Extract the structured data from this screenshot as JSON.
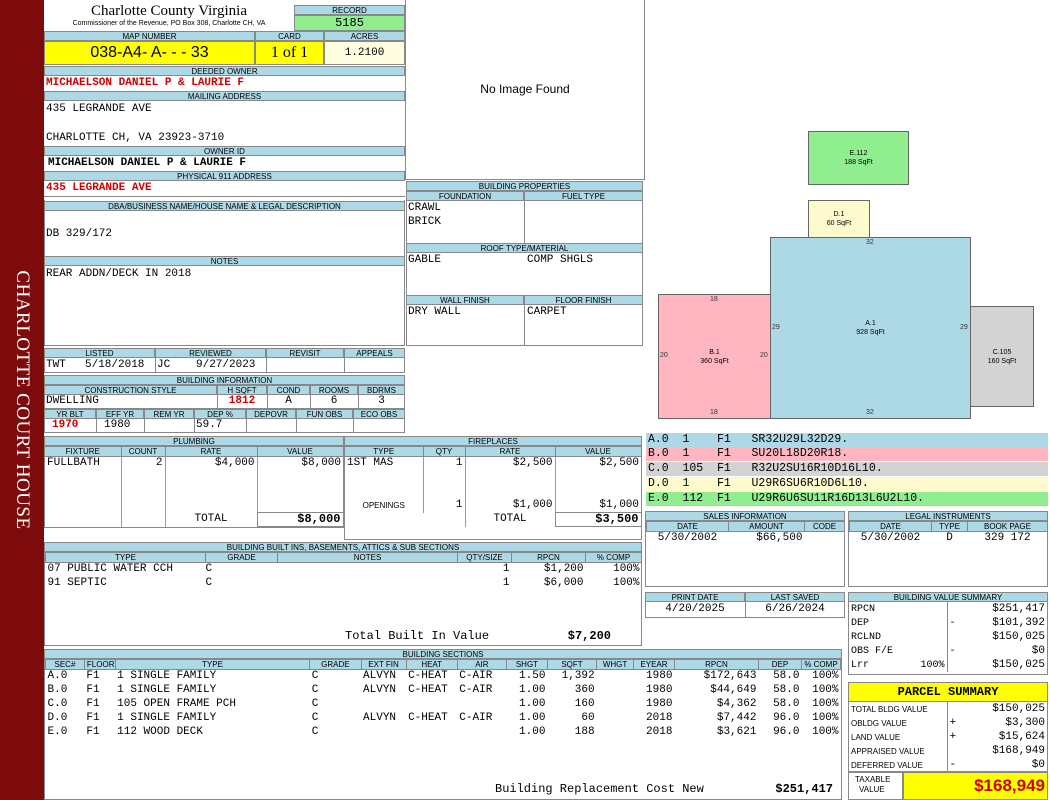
{
  "sidebar": {
    "title": "CHARLOTTE COURT HOUSE"
  },
  "header": {
    "county": "Charlotte County Virginia",
    "subtitle": "Commissioner of the Revenue, PO Box 308, Charlotte CH, VA",
    "record_label": "RECORD",
    "record": "5185",
    "map_label": "MAP NUMBER",
    "map_number": "038-A4- A-  -  - 33",
    "card_label": "CARD",
    "card": "1 of 1",
    "acres_label": "ACRES",
    "acres": "1.2100"
  },
  "owner": {
    "deeded_label": "DEEDED OWNER",
    "deeded": "MICHAELSON DANIEL P & LAURIE F",
    "mailing_label": "MAILING ADDRESS",
    "addr1": "435 LEGRANDE AVE",
    "addr2": "CHARLOTTE CH, VA 23923-3710",
    "owner_id_label": "OWNER ID",
    "owner_id": "MICHAELSON DANIEL P & LAURIE F",
    "phys_label": "PHYSICAL 911 ADDRESS",
    "phys": "435 LEGRANDE AVE"
  },
  "legal": {
    "label": "DBA/BUSINESS NAME/HOUSE NAME & LEGAL DESCRIPTION",
    "text": "DB 329/172"
  },
  "notes": {
    "label": "NOTES",
    "text": "REAR ADDN/DECK IN 2018"
  },
  "image": {
    "text": "No Image Found"
  },
  "bprops": {
    "label": "BUILDING PROPERTIES",
    "foundation_label": "FOUNDATION",
    "fuel_label": "FUEL TYPE",
    "foundation1": "CRAWL",
    "foundation2": "BRICK",
    "roof_label": "ROOF TYPE/MATERIAL",
    "roof1": "GABLE",
    "roof2": "COMP SHGLS",
    "wall_label": "WALL FINISH",
    "floor_label": "FLOOR FINISH",
    "wall": "DRY WALL",
    "floor": "CARPET"
  },
  "listed": {
    "listed_label": "LISTED",
    "reviewed_label": "REVIEWED",
    "revisit_label": "REVISIT",
    "appeals_label": "APPEALS",
    "listed_by": "TWT",
    "listed_date": "5/18/2018",
    "reviewed_by": "JC",
    "reviewed_date": "9/27/2023"
  },
  "binfo": {
    "label": "BUILDING INFORMATION",
    "cs_label": "CONSTRUCTION STYLE",
    "hsqft_label": "H SQFT",
    "cond_label": "COND",
    "rooms_label": "ROOMS",
    "bdrms_label": "BDRMS",
    "style": "DWELLING",
    "hsqft": "1812",
    "cond": "A",
    "rooms": "6",
    "bdrms": "3",
    "yrblt_label": "YR BLT",
    "effyr_label": "EFF YR",
    "remyr_label": "REM YR",
    "dep_label": "DEP %",
    "depovr_label": "DEPOVR",
    "funobs_label": "FUN OBS",
    "ecoobs_label": "ECO OBS",
    "yrblt": "1970",
    "effyr": "1980",
    "dep": "59.7"
  },
  "plumbing": {
    "label": "PLUMBING",
    "cols": [
      "FIXTURE",
      "COUNT",
      "RATE",
      "VALUE"
    ],
    "rows": [
      [
        "FULLBATH",
        "2",
        "$4,000",
        "$8,000"
      ]
    ],
    "total_label": "TOTAL",
    "total": "$8,000"
  },
  "fireplaces": {
    "label": "FIREPLACES",
    "cols": [
      "TYPE",
      "QTY",
      "RATE",
      "VALUE"
    ],
    "rows": [
      [
        "1ST MAS",
        "1",
        "$2,500",
        "$2,500"
      ]
    ],
    "openings_label": "OPENINGS",
    "openings_qty": "1",
    "openings_rate": "$1,000",
    "openings_value": "$1,000",
    "total_label": "TOTAL",
    "total": "$3,500"
  },
  "builtins": {
    "label": "BUILDING BUILT INS, BASEMENTS, ATTICS & SUB SECTIONS",
    "cols": [
      "TYPE",
      "GRADE",
      "NOTES",
      "QTY/SIZE",
      "RPCN",
      "% COMP"
    ],
    "rows": [
      [
        "07 PUBLIC WATER CCH",
        "C",
        "",
        "1",
        "$1,200",
        "100%"
      ],
      [
        "91 SEPTIC",
        "C",
        "",
        "1",
        "$6,000",
        "100%"
      ]
    ],
    "total_label": "Total Built In Value",
    "total": "$7,200"
  },
  "sketch": {
    "sections": [
      {
        "id": "E",
        "label": "E.112",
        "sqft": "188 SqFt",
        "color": "#90ee90"
      },
      {
        "id": "D",
        "label": "D.1",
        "sqft": "60 SqFt",
        "color": "#fffacd"
      },
      {
        "id": "A",
        "label": "A.1",
        "sqft": "928 SqFt",
        "color": "#add8e6"
      },
      {
        "id": "B",
        "label": "B.1",
        "sqft": "360 SqFt",
        "color": "#ffb6c1"
      },
      {
        "id": "C",
        "label": "C.105",
        "sqft": "160 SqFt",
        "color": "#d3d3d3"
      }
    ],
    "dims": {
      "a_top": "32",
      "a_bottom": "32",
      "a_left": "29",
      "a_right": "29",
      "b_top": "18",
      "b_bottom": "18",
      "b_left": "20",
      "b_right": "20"
    }
  },
  "codes": [
    {
      "text": "A.0  1    F1   SR32U29L32D29.",
      "color": "#add8e6"
    },
    {
      "text": "B.0  1    F1   SU20L18D20R18.",
      "color": "#ffb6c1"
    },
    {
      "text": "C.0  105  F1   R32U2SU16R10D16L10.",
      "color": "#d3d3d3"
    },
    {
      "text": "D.0  1    F1   U29R6SU6R10D6L10.",
      "color": "#fffacd"
    },
    {
      "text": "E.0  112  F1   U29R6U6SU11R16D13L6U2L10.",
      "color": "#90ee90"
    }
  ],
  "sales": {
    "label": "SALES INFORMATION",
    "cols": [
      "DATE",
      "AMOUNT",
      "CODE"
    ],
    "rows": [
      [
        "5/30/2002",
        "$66,500",
        ""
      ]
    ]
  },
  "legalinst": {
    "label": "LEGAL INSTRUMENTS",
    "cols": [
      "DATE",
      "TYPE",
      "BOOK PAGE"
    ],
    "rows": [
      [
        "5/30/2002",
        "D",
        "329 172"
      ]
    ]
  },
  "print": {
    "print_label": "PRINT DATE",
    "saved_label": "LAST SAVED",
    "print_date": "4/20/2025",
    "saved_date": "6/26/2024"
  },
  "bvs": {
    "label": "BUILDING VALUE SUMMARY",
    "rows": [
      {
        "k": "RPCN",
        "s": "",
        "v": "$251,417"
      },
      {
        "k": "DEP",
        "s": "-",
        "v": "$101,392"
      },
      {
        "k": "RCLND",
        "s": "",
        "v": "$150,025"
      },
      {
        "k": "OBS F/E",
        "s": "-",
        "v": "$0"
      },
      {
        "k": "Lrr",
        "p": "100%",
        "s": "",
        "v": "$150,025"
      }
    ]
  },
  "parcel": {
    "label": "PARCEL SUMMARY",
    "rows": [
      {
        "k": "TOTAL BLDG VALUE",
        "s": "",
        "v": "$150,025"
      },
      {
        "k": "OBLDG VALUE",
        "s": "+",
        "v": "$3,300"
      },
      {
        "k": "LAND VALUE",
        "s": "+",
        "v": "$15,624"
      },
      {
        "k": "APPRAISED VALUE",
        "s": "",
        "v": "$168,949"
      },
      {
        "k": "DEFERRED VALUE",
        "s": "-",
        "v": "$0"
      }
    ],
    "taxable_label1": "TAXABLE",
    "taxable_label2": "VALUE",
    "taxable": "$168,949"
  },
  "sections": {
    "label": "BUILDING SECTIONS",
    "cols": [
      "SEC#",
      "FLOOR",
      "TYPE",
      "GRADE",
      "EXT FIN",
      "HEAT",
      "AIR",
      "SHGT",
      "SQFT",
      "WHGT",
      "EYEAR",
      "RPCN",
      "DEP",
      "% COMP"
    ],
    "rows": [
      [
        "A.0",
        "F1",
        "1 SINGLE FAMILY",
        "C",
        "ALVYN",
        "C-HEAT",
        "C-AIR",
        "1.50",
        "1,392",
        "",
        "1980",
        "$172,643",
        "58.0",
        "100%"
      ],
      [
        "B.0",
        "F1",
        "1 SINGLE FAMILY",
        "C",
        "ALVYN",
        "C-HEAT",
        "C-AIR",
        "1.00",
        "360",
        "",
        "1980",
        "$44,649",
        "58.0",
        "100%"
      ],
      [
        "C.0",
        "F1",
        "105 OPEN FRAME PCH",
        "C",
        "",
        "",
        "",
        "1.00",
        "160",
        "",
        "1980",
        "$4,362",
        "58.0",
        "100%"
      ],
      [
        "D.0",
        "F1",
        "1 SINGLE FAMILY",
        "C",
        "ALVYN",
        "C-HEAT",
        "C-AIR",
        "1.00",
        "60",
        "",
        "2018",
        "$7,442",
        "96.0",
        "100%"
      ],
      [
        "E.0",
        "F1",
        "112 WOOD DECK",
        "C",
        "",
        "",
        "",
        "1.00",
        "188",
        "",
        "2018",
        "$3,621",
        "96.0",
        "100%"
      ]
    ],
    "brcn_label": "Building Replacement Cost New",
    "brcn": "$251,417"
  }
}
